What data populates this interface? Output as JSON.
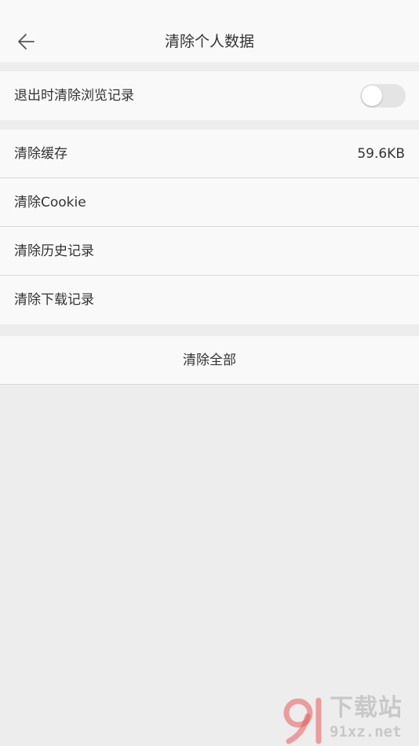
{
  "header": {
    "title": "清除个人数据",
    "back_icon": "arrow-left-icon"
  },
  "exit_clear": {
    "label": "退出时清除浏览记录",
    "toggle_on": false
  },
  "clear_items": [
    {
      "label": "清除缓存",
      "value": "59.6KB"
    },
    {
      "label": "清除Cookie",
      "value": ""
    },
    {
      "label": "清除历史记录",
      "value": ""
    },
    {
      "label": "清除下载记录",
      "value": ""
    }
  ],
  "clear_all": {
    "label": "清除全部"
  },
  "watermark": {
    "cn_text": "下载站",
    "en_text": "91xz.net",
    "logo_text": "91"
  },
  "colors": {
    "background": "#ededed",
    "surface": "#f9f9f9",
    "text": "#333333",
    "divider": "#d8d8d8",
    "toggle_off": "#e4e4e4",
    "watermark": "#c8c8c8",
    "watermark_accent": "#e95a5a"
  }
}
